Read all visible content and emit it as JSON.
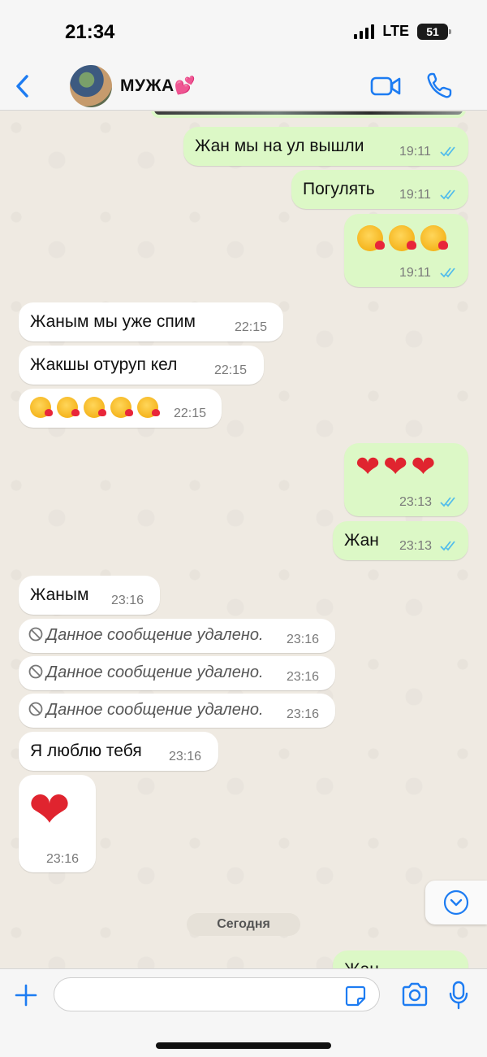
{
  "status_bar": {
    "time": "21:34",
    "network": "LTE",
    "battery": "51"
  },
  "header": {
    "contact_name": "МУЖА💕"
  },
  "messages": {
    "m1": {
      "text": "Жан мы на ул вышли",
      "time": "19:11"
    },
    "m2": {
      "text": "Погулять",
      "time": "19:11"
    },
    "m3": {
      "time": "19:11"
    },
    "m4": {
      "text": "Жаным мы уже спим",
      "time": "22:15"
    },
    "m5": {
      "text": "Жакшы отуруп кел",
      "time": "22:15"
    },
    "m6": {
      "time": "22:15"
    },
    "m7": {
      "emoji": "❤❤❤",
      "time": "23:13"
    },
    "m8": {
      "text": "Жан",
      "time": "23:13"
    },
    "m9": {
      "text": "Жаным",
      "time": "23:16"
    },
    "m10": {
      "text": "Данное сообщение удалено.",
      "time": "23:16"
    },
    "m11": {
      "text": "Данное сообщение удалено.",
      "time": "23:16"
    },
    "m12": {
      "text": "Данное сообщение удалено.",
      "time": "23:16"
    },
    "m13": {
      "text": "Я люблю тебя",
      "time": "23:16"
    },
    "m14": {
      "emoji": "❤",
      "time": "23:16"
    },
    "m15": {
      "text": "Жан"
    }
  },
  "date_divider": "Сегодня",
  "composer": {
    "placeholder": ""
  },
  "colors": {
    "outgoing": "#dcf8c6",
    "incoming": "#ffffff",
    "accent": "#1d7cf2",
    "read_ticks": "#53bdeb"
  }
}
